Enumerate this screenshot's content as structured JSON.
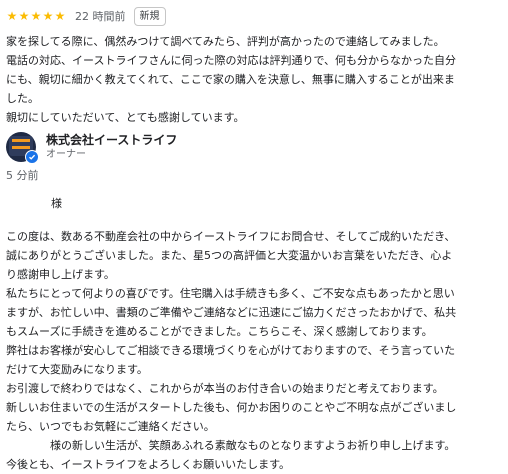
{
  "review": {
    "stars": 5,
    "star_glyph": "★",
    "time": "22 時間前",
    "badge": "新規",
    "lines": [
      "家を探してる際に、偶然みつけて調べてみたら、評判が高かったので連絡してみました。",
      "電話の対応、イーストライフさんに伺った際の対応は評判通りで、何も分からなかった自分",
      "にも、親切に細かく教えてくれて、ここで家の購入を決意し、無事に購入することが出来ま",
      "した。",
      "親切にしていただいて、とても感謝しています。"
    ]
  },
  "owner": {
    "name": "株式会社イーストライフ",
    "role": "オーナー",
    "avatar_icon": "company-logo",
    "verified_icon": "verified-check-icon",
    "brand_color": "#f29a1f"
  },
  "reply": {
    "time": "5 分前",
    "salutation": "様",
    "lines": [
      "この度は、数ある不動産会社の中からイーストライフにお問合せ、そしてご成約いただき、",
      "誠にありがとうございました。また、星5つの高評価と大変温かいお言葉をいただき、心よ",
      "り感謝申し上げます。",
      "私たちにとって何よりの喜びです。住宅購入は手続きも多く、ご不安な点もあったかと思い",
      "ますが、お忙しい中、書類のご準備やご連絡などに迅速にご協力くださったおかげで、私共",
      "もスムーズに手続きを進めることができました。こちらこそ、深く感謝しております。",
      "弊社はお客様が安心してご相談できる環境づくりを心がけておりますので、そう言っていた",
      "だけて大変励みになります。",
      "お引渡しで終わりではなく、これからが本当のお付き合いの始まりだと考えております。",
      "新しいお住まいでの生活がスタートした後も、何かお困りのことやご不明な点がございまし",
      "たら、いつでもお気軽にご連絡ください。",
      "様の新しい生活が、笑顔あふれる素敵なものとなりますようお祈り申し上げます。",
      "今後とも、イーストライフをよろしくお願いいたします。"
    ]
  }
}
